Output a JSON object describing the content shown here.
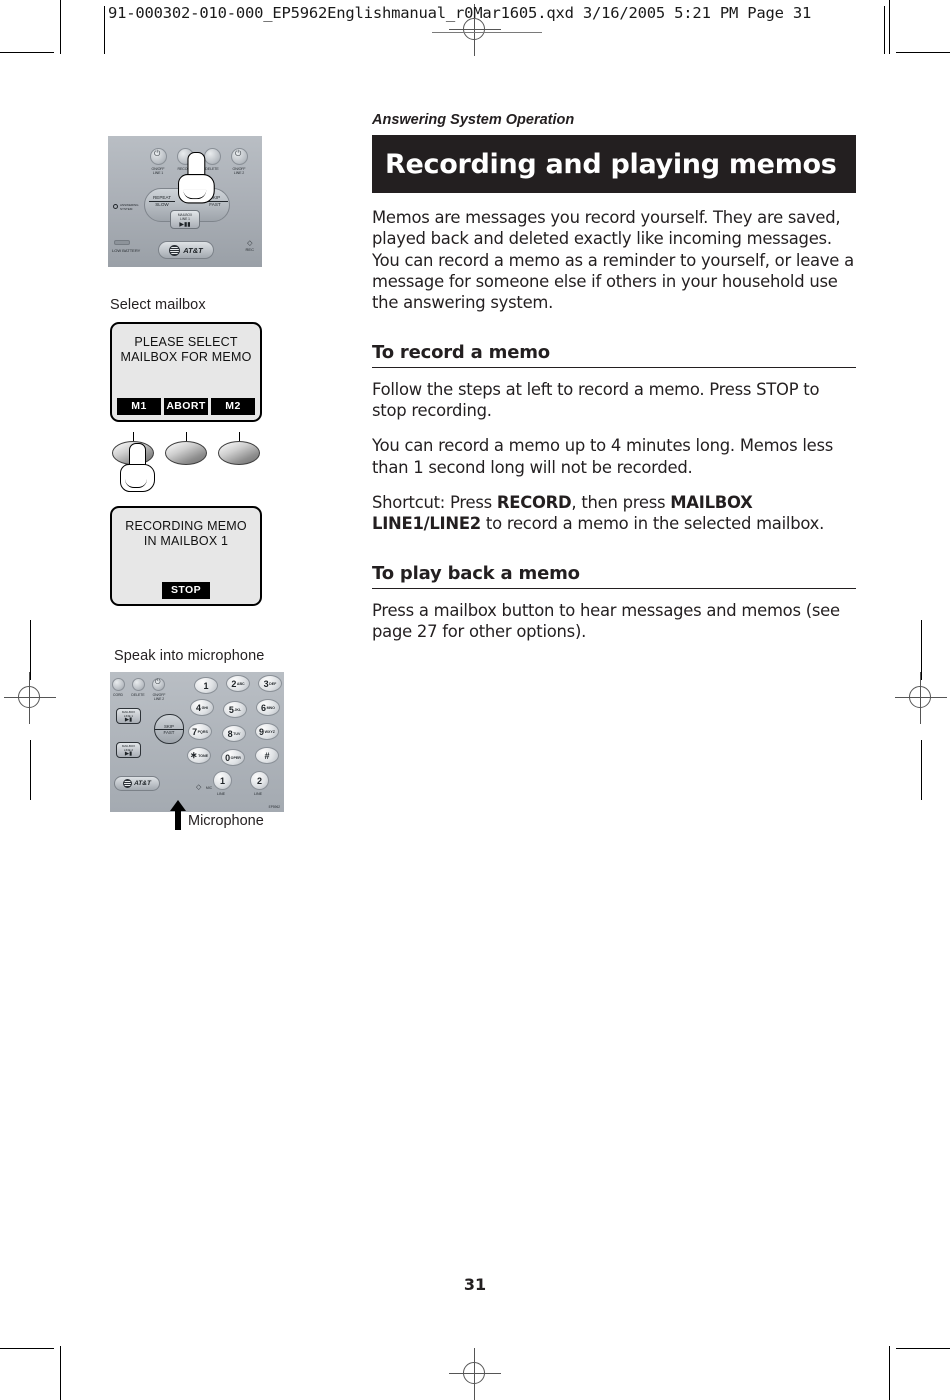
{
  "prepress": {
    "running_header": "91-000302-010-000_EP5962Englishmanual_r0Mar1605.qxd  3/16/2005  5:21 PM  Page 31"
  },
  "page": {
    "number": "31"
  },
  "article": {
    "eyebrow": "Answering System Operation",
    "banner_title": "Recording and playing memos",
    "intro": "Memos are messages you record yourself. They are saved, played back and deleted exactly like incoming messages. You can record a memo as a reminder to yourself, or leave a message for someone else if others in your household use the answering system.",
    "sections": [
      {
        "heading": "To record a memo",
        "paragraphs": [
          "Follow the steps at left to record a memo. Press STOP to stop recording.",
          "You can record a memo up to 4 minutes long. Memos less than 1 second long will not be recorded."
        ],
        "shortcut": {
          "prefix": "Shortcut: Press ",
          "key1": "RECORD",
          "middle": ",  then press ",
          "key2": "MAILBOX LINE1/LINE2",
          "suffix": " to record a memo in the selected mailbox."
        }
      },
      {
        "heading": "To play back a memo",
        "paragraphs": [
          "Press a mailbox button to hear messages and memos (see page 27 for other options)."
        ]
      }
    ]
  },
  "figures": {
    "base_unit": {
      "top_buttons": [
        {
          "label_line1": "ON/OFF",
          "label_line2": "LINE 1",
          "glyph": "⏻"
        },
        {
          "label_line1": "RECORD",
          "label_line2": "",
          "glyph": ""
        },
        {
          "label_line1": "DELETE",
          "label_line2": "",
          "glyph": ""
        },
        {
          "label_line1": "ON/OFF",
          "label_line2": "LINE 2",
          "glyph": "⏻"
        }
      ],
      "rocker_left_top": "REPEAT",
      "rocker_left_bottom": "SLOW",
      "rocker_right_top": "SKIP",
      "rocker_right_bottom": "FAST",
      "mailbox_label": "MAILBOX",
      "mailbox_line": "LINE 1",
      "mailbox_glyph": "▶▐▐",
      "brand": "AT&T",
      "low_battery": "LOW BATTERY",
      "rec_indicator": "REC",
      "answering_system": "ANSWERING SYSTEM"
    },
    "select_mailbox": {
      "caption": "Select mailbox",
      "lcd_line1": "PLEASE SELECT",
      "lcd_line2": "MAILBOX FOR MEMO",
      "softkeys": [
        "M1",
        "ABORT",
        "M2"
      ]
    },
    "recording_memo": {
      "lcd_line1": "RECORDING MEMO",
      "lcd_line2": "IN MAILBOX 1",
      "softkeys": [
        "STOP"
      ]
    },
    "microphone": {
      "caption": "Speak into microphone",
      "arrow_label": "Microphone",
      "mic_label": "MIC",
      "keypad": [
        {
          "digit": "1",
          "letters": ""
        },
        {
          "digit": "2",
          "letters": "ABC"
        },
        {
          "digit": "3",
          "letters": "DEF"
        },
        {
          "digit": "4",
          "letters": "GHI"
        },
        {
          "digit": "5",
          "letters": "JKL"
        },
        {
          "digit": "6",
          "letters": "MNO"
        },
        {
          "digit": "7",
          "letters": "PQRS"
        },
        {
          "digit": "8",
          "letters": "TUV"
        },
        {
          "digit": "9",
          "letters": "WXYZ"
        },
        {
          "digit": "∗",
          "letters": "TONE"
        },
        {
          "digit": "0",
          "letters": "OPER"
        },
        {
          "digit": "#",
          "letters": ""
        }
      ],
      "line_buttons": [
        {
          "digit": "1",
          "label": "LINE"
        },
        {
          "digit": "2",
          "label": "LINE"
        }
      ],
      "top_labels": [
        "CORD",
        "DELETE",
        "ON/OFF LINE 2"
      ],
      "mailbox1": "MAILBOX LINE 1",
      "mailbox2": "MAILBOX LINE 2",
      "skip": "SKIP",
      "fast": "FAST",
      "brand": "AT&T",
      "model": "EP5962"
    }
  },
  "colors": {
    "banner_bg": "#231f20",
    "text": "#231f20",
    "lcd_bg": "#e7e7e7",
    "device_body": "#aeb3ba"
  }
}
